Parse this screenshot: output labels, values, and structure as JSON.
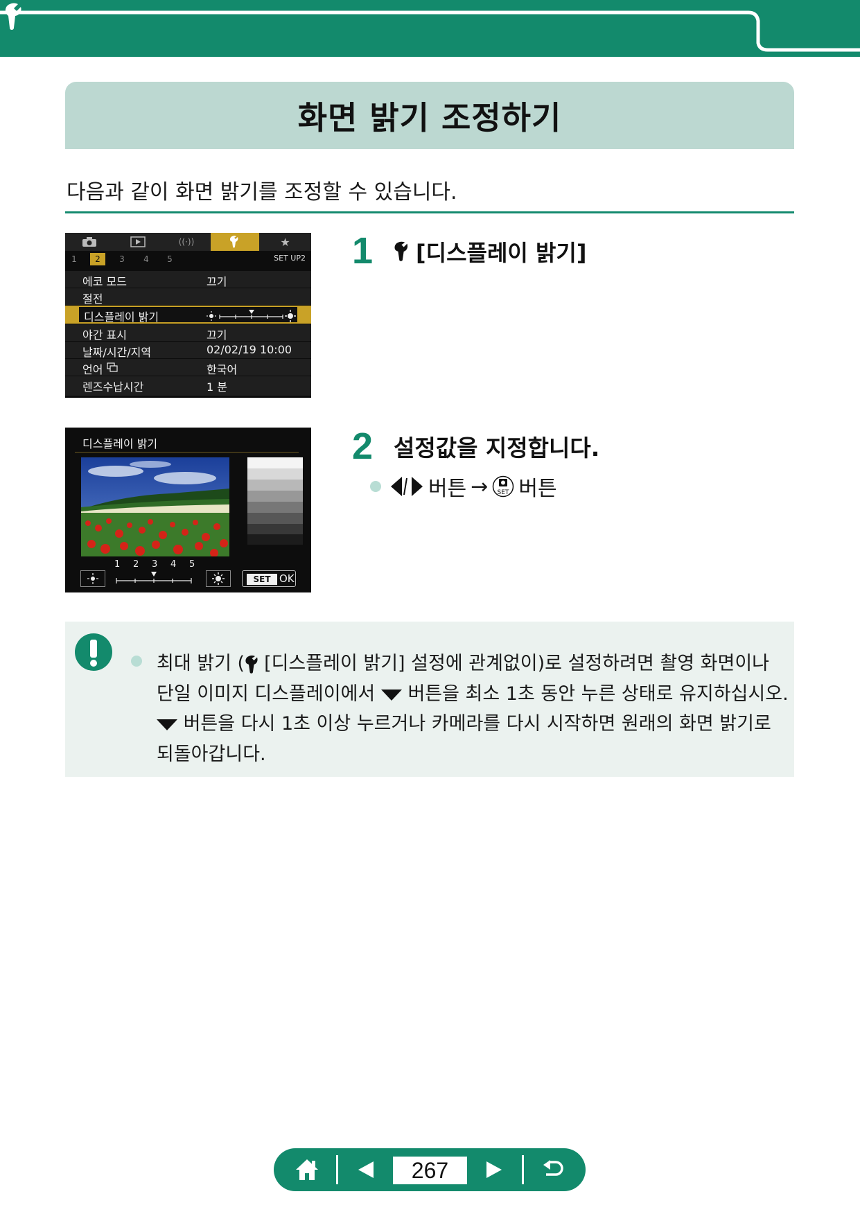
{
  "header": {
    "section_icon": "wrench-icon",
    "accent_color": "#138a6c"
  },
  "page_title": "화면 밝기 조정하기",
  "intro": "다음과 같이 화면 밝기를 조정할 수 있습니다.",
  "screen1": {
    "tab_icons": [
      "camera-icon",
      "playback-icon",
      "wireless-icon",
      "wrench-icon",
      "star-icon"
    ],
    "subtabs": [
      "1",
      "2",
      "3",
      "4",
      "5"
    ],
    "active_subtab": "2",
    "page_label": "SET UP2",
    "rows": [
      {
        "label": "에코 모드",
        "value": "끄기"
      },
      {
        "label": "절전",
        "value": ""
      },
      {
        "label": "디스플레이 밝기",
        "value": ""
      },
      {
        "label": "야간 표시",
        "value": "끄기"
      },
      {
        "label": "날짜/시간/지역",
        "value": "02/02/19  10:00"
      },
      {
        "label": "언어",
        "value": "한국어"
      },
      {
        "label": "렌즈수납시간",
        "value": "1 분"
      }
    ]
  },
  "screen2": {
    "title": "디스플레이 밝기",
    "levels": [
      "1",
      "2",
      "3",
      "4",
      "5"
    ],
    "current_level": 3,
    "set_label": "SET",
    "ok_label": "OK"
  },
  "steps": [
    {
      "number": "1",
      "text": "[디스플레이 밝기]"
    },
    {
      "number": "2",
      "text": "설정값을 지정합니다.",
      "bullet_a": "버튼",
      "arrow": "→",
      "bullet_b": "버튼"
    }
  ],
  "note": {
    "line1_a": "최대 밝기 (",
    "line1_b": "[디스플레이 밝기] 설정에 관계없이)로 설정하려면 촬영 화면이나",
    "line2_a": "단일 이미지 디스플레이에서",
    "line2_b": "버튼을 최소 1초 동안 누른 상태로 유지하십시오.",
    "line3": "버튼을 다시 1초 이상 누르거나 카메라를 다시 시작하면 원래의 화면 밝기로",
    "line4": "되돌아갑니다."
  },
  "nav": {
    "page_number": "267"
  }
}
